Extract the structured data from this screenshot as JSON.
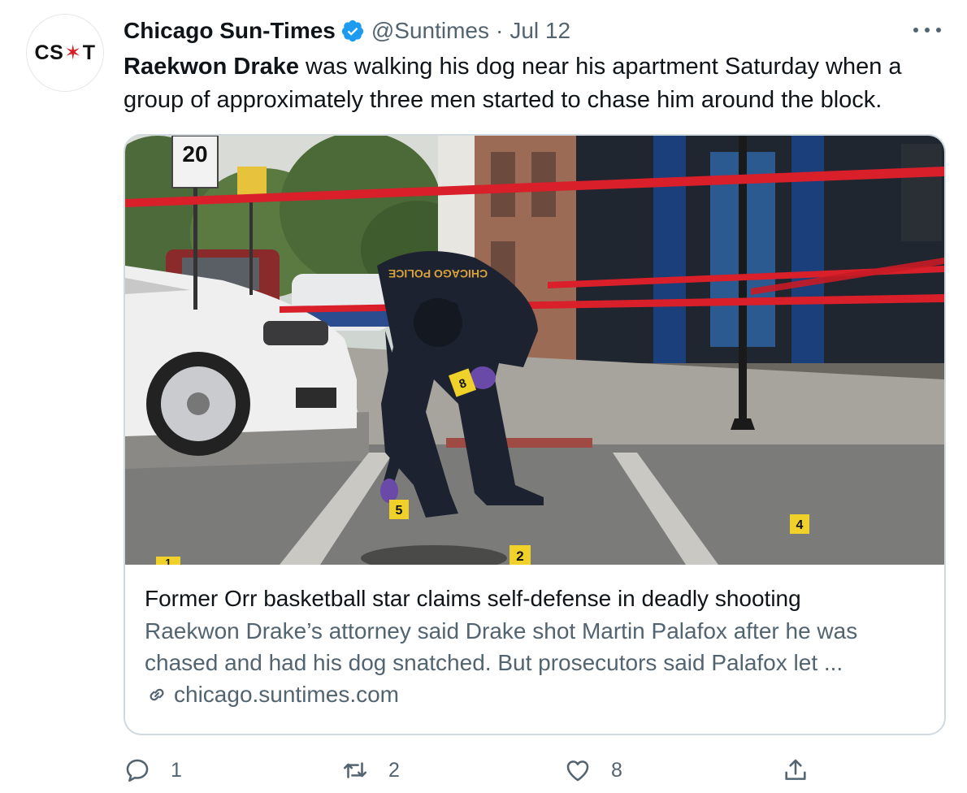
{
  "tweet": {
    "avatar": {
      "left": "CS",
      "star": "✶",
      "right": "T"
    },
    "display_name": "Chicago Sun-Times",
    "handle": "@Suntimes",
    "separator": "·",
    "date": "Jul 12",
    "text_bold": "Raekwon Drake",
    "text_rest": " was walking his dog near his apartment Saturday when a group of approximately three men started to chase him around the block."
  },
  "card": {
    "title": "Former Orr basketball star claims self-defense in deadly shooting",
    "description": "Raekwon Drake’s attorney said Drake shot Martin Palafox after he was chased and had his dog snatched. But prosecutors said Palafox let ...",
    "domain": "chicago.suntimes.com",
    "photo": {
      "speed_sign": "20",
      "police_jacket_text": "CHICAGO POLICE",
      "markers": [
        "1",
        "2",
        "4",
        "5",
        "8"
      ]
    }
  },
  "actions": {
    "reply_count": "1",
    "retweet_count": "2",
    "like_count": "8"
  },
  "colors": {
    "text": "#0f1419",
    "secondary": "#536471",
    "verified": "#1d9bf0",
    "border": "#cfd9de",
    "crime_tape": "#d81f2a"
  }
}
